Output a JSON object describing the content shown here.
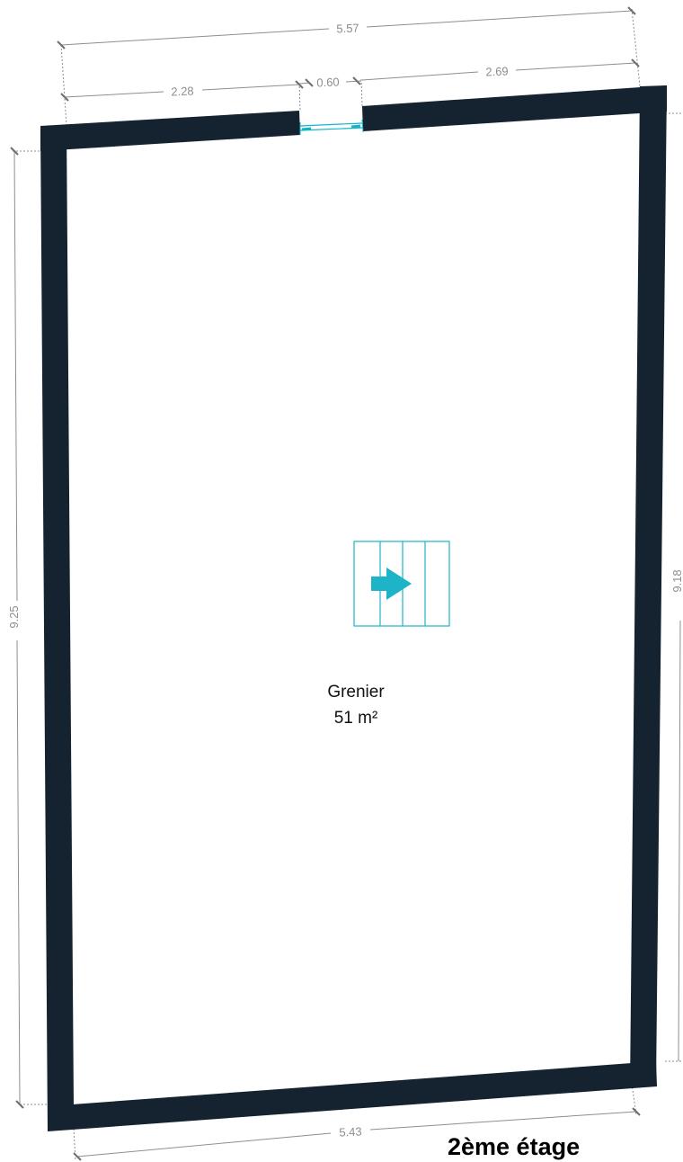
{
  "plan": {
    "floor_label": "2ème étage",
    "room": {
      "name": "Grenier",
      "area": "51 m²"
    },
    "dimensions": {
      "top_total": "5.57",
      "top_left": "2.28",
      "top_opening": "0.60",
      "top_right": "2.69",
      "left_height": "9.25",
      "bottom_total": "5.43",
      "right_height": "9.18"
    },
    "colors": {
      "wall": "#14232f",
      "window": "#11b6c9",
      "stair": "#1cb4c6",
      "dimension": "#8a8f94"
    },
    "icons": [
      "window-icon",
      "stair-icon",
      "stair-direction-arrow-icon"
    ]
  }
}
